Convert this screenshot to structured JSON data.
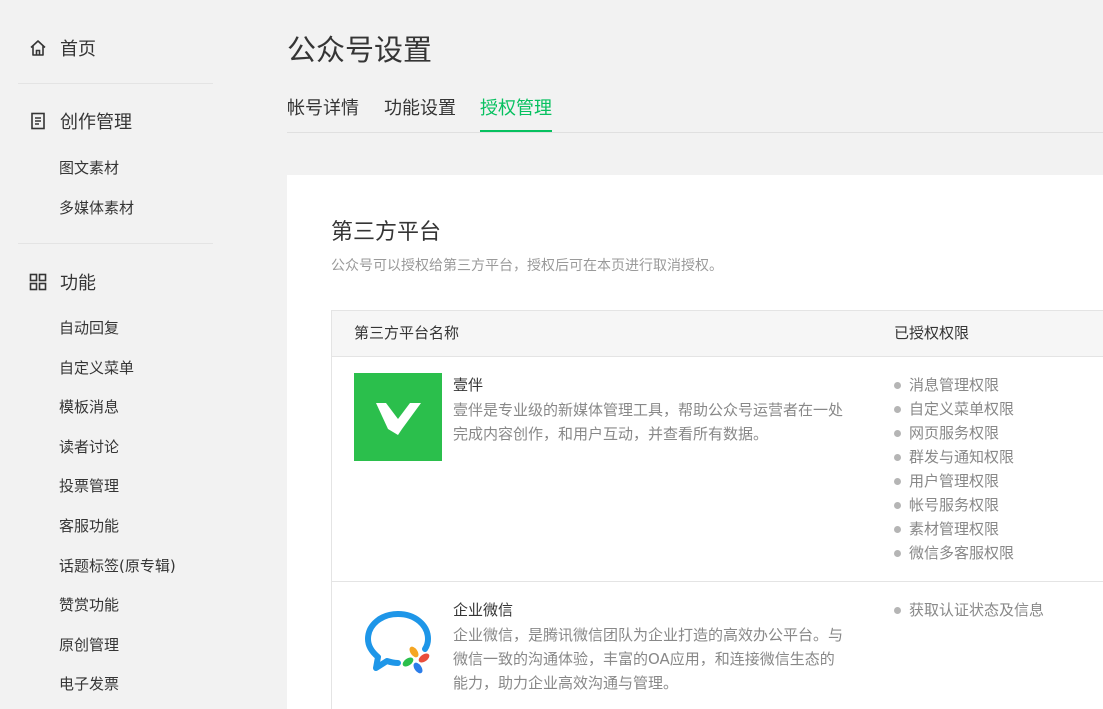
{
  "sidebar": {
    "home": "首页",
    "creation": "创作管理",
    "creation_items": [
      "图文素材",
      "多媒体素材"
    ],
    "features": "功能",
    "feature_items": [
      "自动回复",
      "自定义菜单",
      "模板消息",
      "读者讨论",
      "投票管理",
      "客服功能",
      "话题标签(原专辑)",
      "赞赏功能",
      "原创管理",
      "电子发票"
    ]
  },
  "header": {
    "title": "公众号设置",
    "tabs": [
      "帐号详情",
      "功能设置",
      "授权管理"
    ],
    "active_tab": "授权管理"
  },
  "section": {
    "title": "第三方平台",
    "description": "公众号可以授权给第三方平台，授权后可在本页进行取消授权。",
    "columns": [
      "第三方平台名称",
      "已授权权限"
    ],
    "platforms": [
      {
        "name": "壹伴",
        "description": "壹伴是专业级的新媒体管理工具，帮助公众号运营者在一处完成内容创作，和用户互动，并查看所有数据。",
        "logo_icon": "yiban-logo-icon",
        "permissions": [
          "消息管理权限",
          "自定义菜单权限",
          "网页服务权限",
          "群发与通知权限",
          "用户管理权限",
          "帐号服务权限",
          "素材管理权限",
          "微信多客服权限"
        ]
      },
      {
        "name": "企业微信",
        "description": "企业微信，是腾讯微信团队为企业打造的高效办公平台。与微信一致的沟通体验，丰富的OA应用，和连接微信生态的能力，助力企业高效沟通与管理。",
        "logo_icon": "wecom-logo-icon",
        "permissions": [
          "获取认证状态及信息"
        ]
      }
    ]
  },
  "colors": {
    "accent": "#07c160",
    "yiban_green": "#2bbf4c",
    "text": "#353535",
    "muted": "#888888"
  }
}
